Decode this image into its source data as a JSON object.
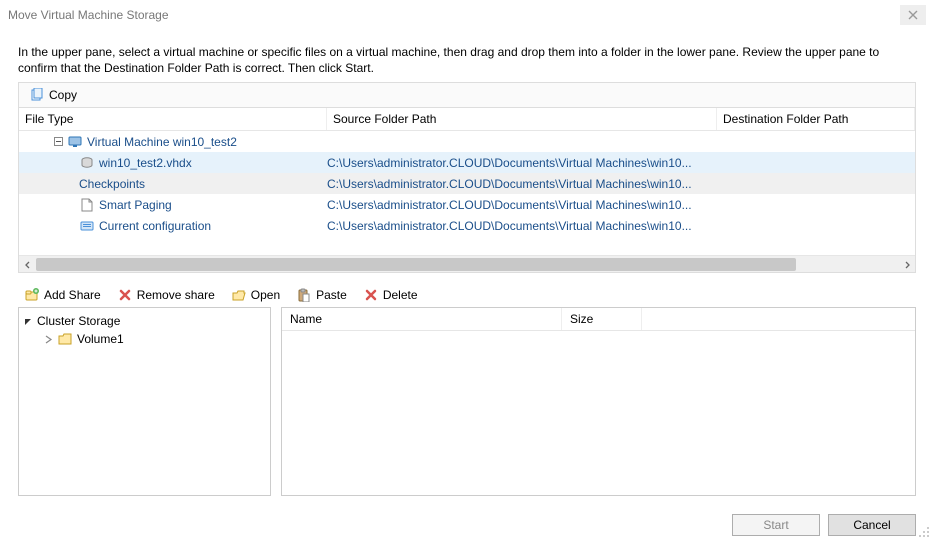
{
  "window": {
    "title": "Move Virtual Machine Storage"
  },
  "instructions": "In the upper pane, select a virtual machine or specific files on a virtual machine, then drag and drop them into a folder in the lower pane.  Review the upper pane to confirm that the Destination Folder Path is correct. Then click Start.",
  "upper_toolbar": {
    "copy": "Copy"
  },
  "grid": {
    "columns": {
      "file_type": "File Type",
      "source": "Source Folder Path",
      "dest": "Destination Folder Path"
    },
    "rows": [
      {
        "label": "Virtual Machine win10_test2",
        "source": "",
        "kind": "vm",
        "selected": false
      },
      {
        "label": "win10_test2.vhdx",
        "source": "C:\\Users\\administrator.CLOUD\\Documents\\Virtual Machines\\win10...",
        "kind": "vhd",
        "selected": "primary"
      },
      {
        "label": "Checkpoints",
        "source": "C:\\Users\\administrator.CLOUD\\Documents\\Virtual Machines\\win10...",
        "kind": "folder",
        "selected": "secondary"
      },
      {
        "label": "Smart Paging",
        "source": "C:\\Users\\administrator.CLOUD\\Documents\\Virtual Machines\\win10...",
        "kind": "file",
        "selected": false
      },
      {
        "label": "Current configuration",
        "source": "C:\\Users\\administrator.CLOUD\\Documents\\Virtual Machines\\win10...",
        "kind": "config",
        "selected": false
      }
    ]
  },
  "midbar": {
    "add_share": "Add Share",
    "remove_share": "Remove share",
    "open": "Open",
    "paste": "Paste",
    "delete": "Delete"
  },
  "tree": {
    "root": "Cluster Storage",
    "children": [
      {
        "label": "Volume1"
      }
    ]
  },
  "list": {
    "columns": {
      "name": "Name",
      "size": "Size"
    }
  },
  "buttons": {
    "start": "Start",
    "cancel": "Cancel"
  }
}
